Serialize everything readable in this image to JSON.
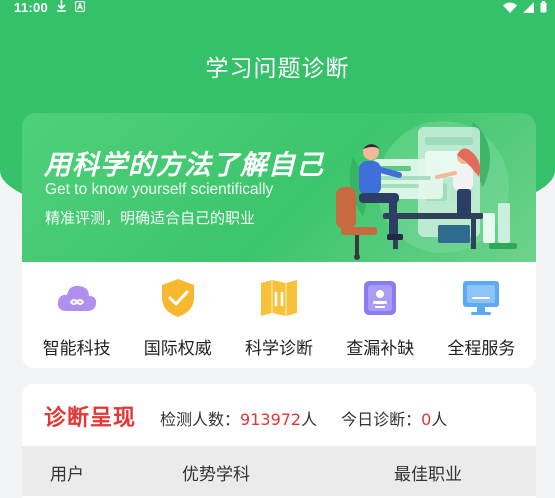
{
  "status_bar": {
    "time": "11:00"
  },
  "header": {
    "title": "学习问题诊断"
  },
  "banner": {
    "slogan": "用科学的方法了解自己",
    "slogan_en": "Get to know yourself scientifically",
    "subtitle": "精准评测，明确适合自己的职业"
  },
  "features": [
    {
      "label": "智能科技",
      "icon": "cloud-infinity-icon",
      "color": "#b18ff0"
    },
    {
      "label": "国际权威",
      "icon": "shield-check-icon",
      "color": "#f7b82f"
    },
    {
      "label": "科学诊断",
      "icon": "map-book-icon",
      "color": "#f7c23a"
    },
    {
      "label": "查漏补缺",
      "icon": "badge-card-icon",
      "color": "#8a7df0"
    },
    {
      "label": "全程服务",
      "icon": "monitor-icon",
      "color": "#5ea9f5"
    }
  ],
  "diagnosis": {
    "title": "诊断呈现",
    "detect_label": "检测人数：",
    "detect_count": "913972",
    "detect_unit": "人",
    "today_label": "今日诊断：",
    "today_count": "0",
    "today_unit": "人",
    "columns": [
      "用户",
      "优势学科",
      "最佳职业"
    ]
  },
  "colors": {
    "brand_green": "#34c16a",
    "accent_red": "#e53535"
  }
}
